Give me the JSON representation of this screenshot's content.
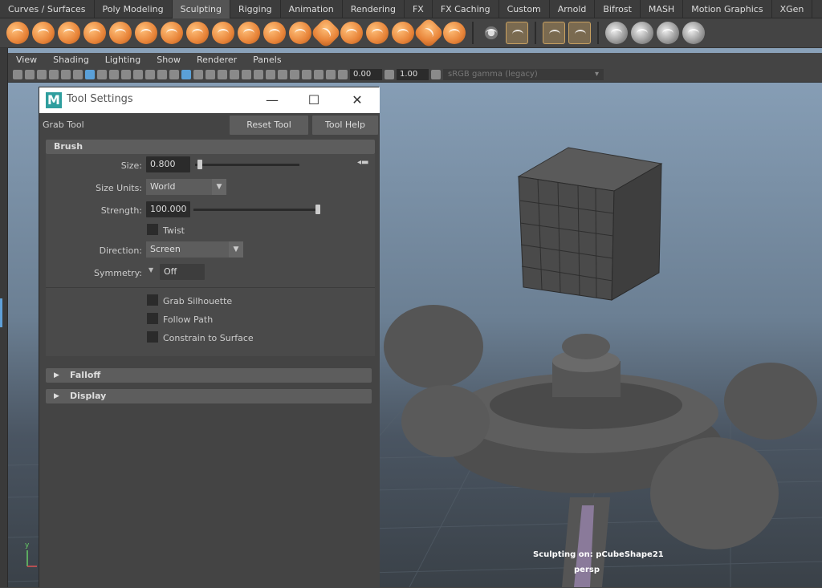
{
  "shelf": {
    "tabs": [
      "Curves / Surfaces",
      "Poly Modeling",
      "Sculpting",
      "Rigging",
      "Animation",
      "Rendering",
      "FX",
      "FX Caching",
      "Custom",
      "Arnold",
      "Bifrost",
      "MASH",
      "Motion Graphics",
      "XGen"
    ],
    "active_tab": "Sculpting",
    "accent": "#e8853a"
  },
  "viewport": {
    "menu": [
      "View",
      "Shading",
      "Lighting",
      "Show",
      "Renderer",
      "Panels"
    ],
    "exposure": "0.00",
    "gamma": "1.00",
    "color_space": "sRGB gamma (legacy)",
    "hud_sculpting": "Sculpting on: pCubeShape21",
    "camera": "persp",
    "axis_y": "y",
    "axis_x": "x"
  },
  "tool_settings": {
    "window_title": "Tool Settings",
    "logo_letter": "M",
    "tool_name": "Grab Tool",
    "reset_label": "Reset Tool",
    "help_label": "Tool Help",
    "brush": {
      "title": "Brush",
      "size_label": "Size:",
      "size_value": "0.800",
      "size_fraction": 0.02,
      "size_units_label": "Size Units:",
      "size_units_value": "World",
      "strength_label": "Strength:",
      "strength_value": "100.000",
      "strength_fraction": 1.0,
      "twist_label": "Twist",
      "direction_label": "Direction:",
      "direction_value": "Screen",
      "symmetry_label": "Symmetry:",
      "symmetry_value": "Off",
      "grab_silhouette_label": "Grab Silhouette",
      "follow_path_label": "Follow Path",
      "constrain_label": "Constrain to Surface"
    },
    "falloff_title": "Falloff",
    "display_title": "Display"
  }
}
